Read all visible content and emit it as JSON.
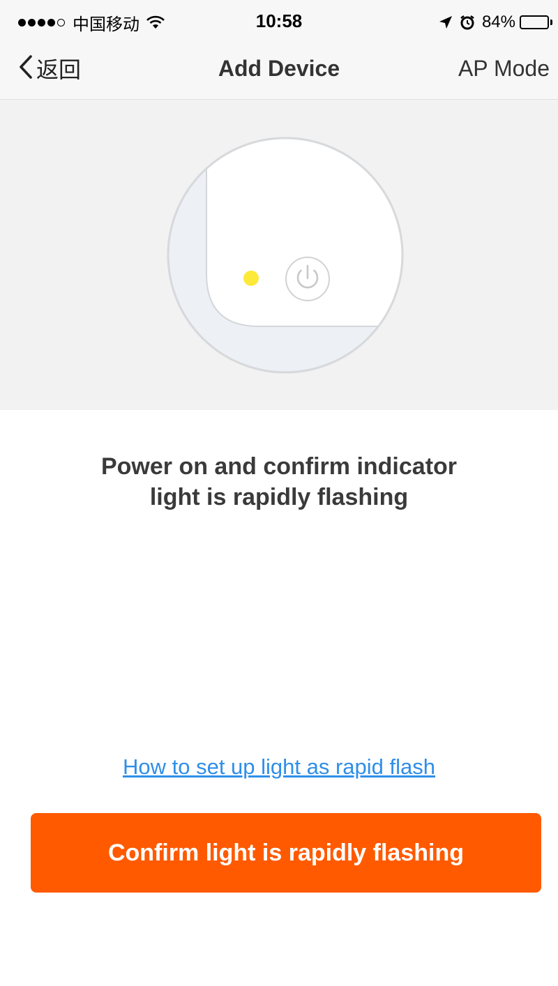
{
  "status_bar": {
    "carrier": "中国移动",
    "time": "10:58",
    "battery_percent": "84%",
    "battery_level": 0.84,
    "icons": [
      "signal-dots-icon",
      "wifi-icon",
      "location-arrow-icon",
      "alarm-clock-icon",
      "battery-icon"
    ]
  },
  "nav": {
    "back_label": "返回",
    "title": "Add Device",
    "right_label": "AP Mode"
  },
  "illustration": {
    "indicator_color": "#fde93a",
    "icons": [
      "device-corner-illustration",
      "indicator-light-icon",
      "power-button-icon"
    ]
  },
  "instruction": {
    "line1": "Power on and confirm indicator",
    "line2": "light is rapidly flashing"
  },
  "help_link": "How to set up light as rapid flash",
  "confirm_button": "Confirm light is rapidly flashing",
  "colors": {
    "accent": "#ff5a00",
    "link": "#2f8ee8",
    "indicator": "#fde93a"
  }
}
